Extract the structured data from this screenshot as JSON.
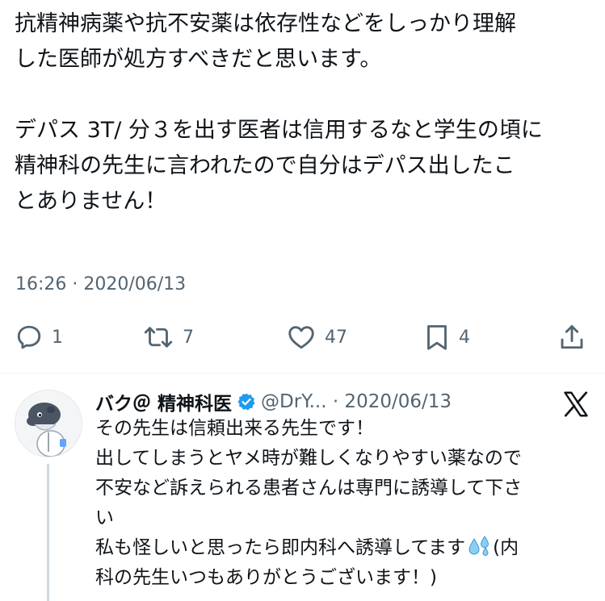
{
  "tweet": {
    "lines": [
      "抗精神病薬や抗不安薬は依存性などをしっかり理解",
      "した医師が処方すべきだと思います。",
      "",
      "デパス 3T/ 分３を出す医者は信用するなと学生の頃に",
      "精神科の先生に言われたので自分はデパス出したこ",
      "とありません！"
    ],
    "timestamp": "16:26 · 2020/06/13"
  },
  "actions": {
    "reply_count": "1",
    "retweet_count": "7",
    "like_count": "47",
    "bookmark_count": "4",
    "icons": [
      "reply-icon",
      "retweet-icon",
      "like-icon",
      "bookmark-icon",
      "share-icon"
    ]
  },
  "reply": {
    "name": "バク＠ 精神科医",
    "handle": "@DrY... · 2020/06/13",
    "lines": [
      "その先生は信頼出来る先生です！",
      "出してしまうとヤメ時が難しくなりやすい薬なので",
      "不安など訴えられる患者さんは専門に誘導して下さ",
      "い",
      "私も怪しいと思ったら即内科へ誘導してます",
      "(内",
      "科の先生いつもありがとうございます！)"
    ],
    "verified_color": "#1d9bf0"
  },
  "colors": {
    "text": "#0f1419",
    "secondary": "#536471",
    "divider": "#eff3f4"
  }
}
